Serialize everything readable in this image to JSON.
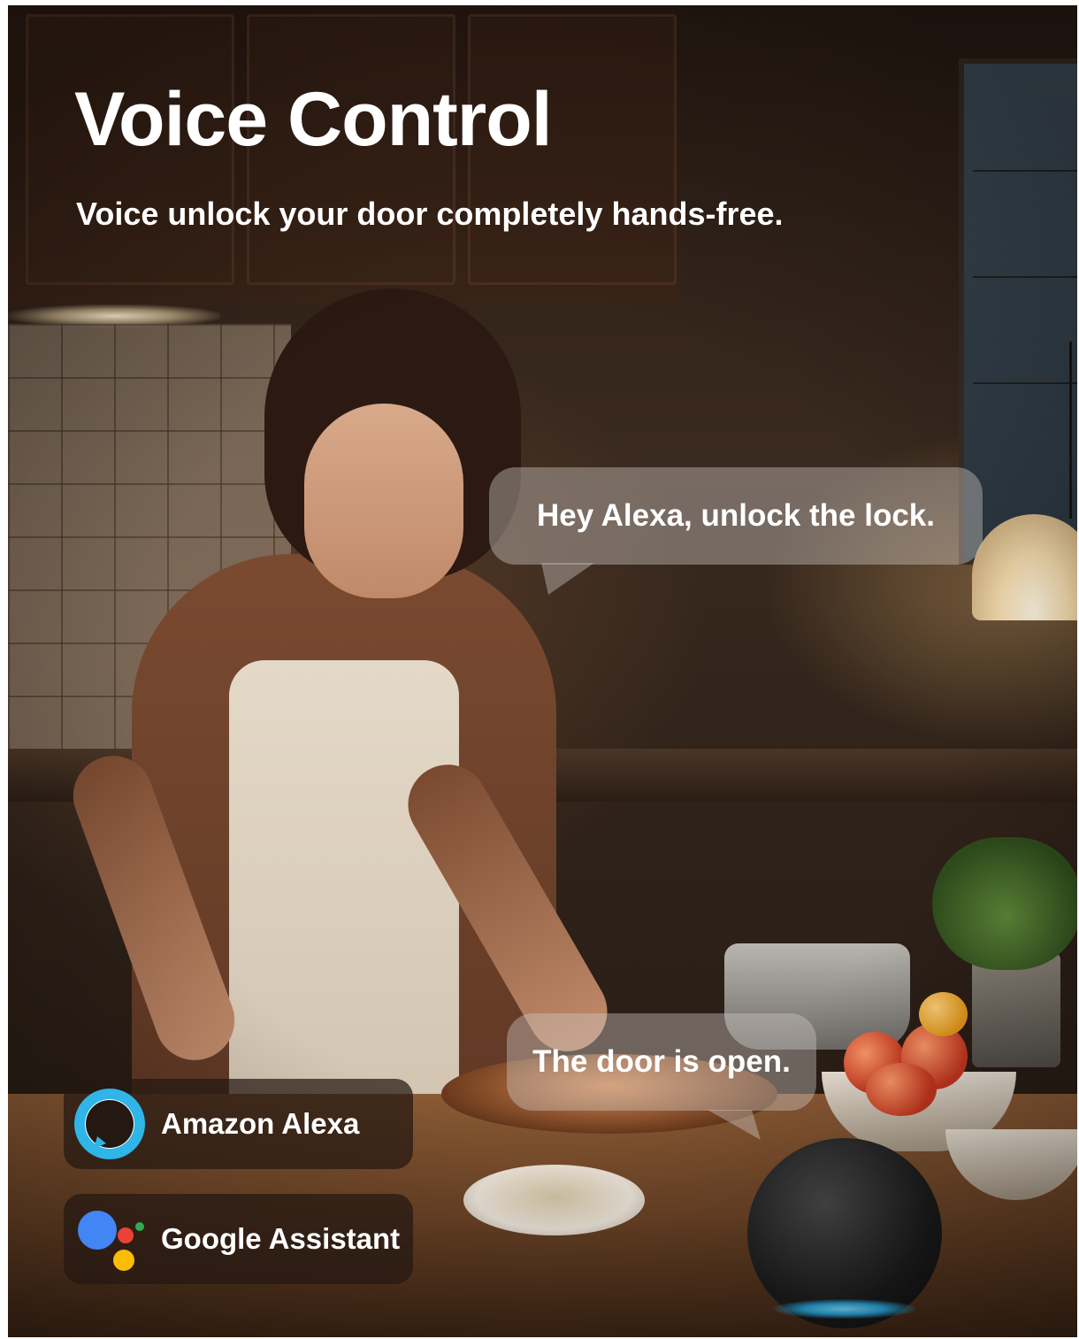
{
  "headline": {
    "title": "Voice Control",
    "subtitle": "Voice unlock your door completely hands-free."
  },
  "speech_bubbles": [
    {
      "text": "Hey Alexa, unlock the lock."
    },
    {
      "text": "The door is open."
    }
  ],
  "assistants": [
    {
      "label": "Amazon Alexa",
      "icon": "alexa-logo-icon"
    },
    {
      "label": "Google Assistant",
      "icon": "google-assistant-logo-icon"
    }
  ],
  "colors": {
    "text": "#ffffff",
    "alexa_blue": "#2fb5e8",
    "google_blue": "#4285f4",
    "google_red": "#ea4335",
    "google_yellow": "#fbbc05",
    "google_green": "#34a853",
    "speaker_light": "#2aa8e0"
  }
}
